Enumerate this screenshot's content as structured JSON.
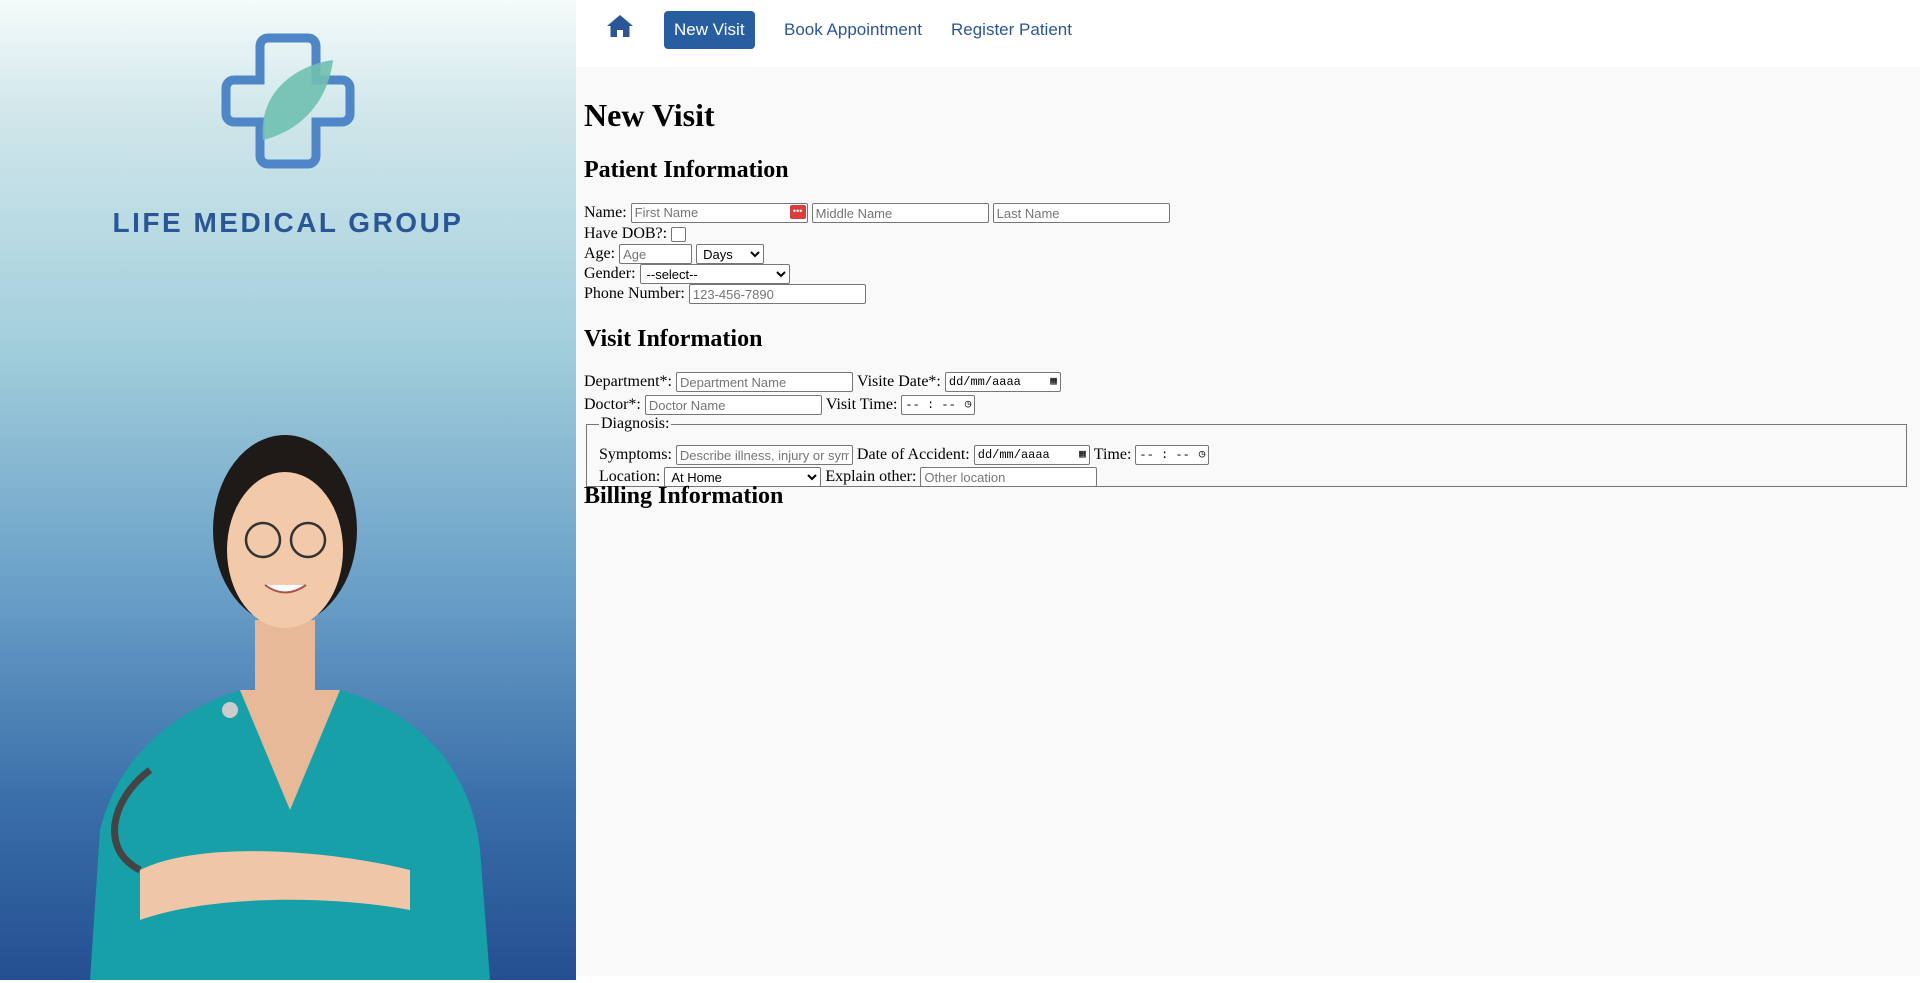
{
  "brand": {
    "name": "LIFE MEDICAL GROUP"
  },
  "nav": {
    "home_icon": "home-icon",
    "items": [
      {
        "label": "New Visit",
        "active": true
      },
      {
        "label": "Book Appointment",
        "active": false
      },
      {
        "label": "Register Patient",
        "active": false
      }
    ]
  },
  "page": {
    "title": "New Visit"
  },
  "patient": {
    "heading": "Patient Information",
    "name_label": "Name:",
    "first_placeholder": "First Name",
    "middle_placeholder": "Middle Name",
    "last_placeholder": "Last Name",
    "dob_label": "Have DOB?:",
    "age_label": "Age:",
    "age_placeholder": "Age",
    "age_unit": "Days",
    "gender_label": "Gender:",
    "gender_value": "--select--",
    "phone_label": "Phone Number:",
    "phone_placeholder": "123-456-7890"
  },
  "visit": {
    "heading": "Visit Information",
    "department_label": "Department*:",
    "department_placeholder": "Department Name",
    "visit_date_label": "Visite Date*:",
    "date_placeholder": "dd/mm/aaaa",
    "doctor_label": "Doctor*:",
    "doctor_placeholder": "Doctor Name",
    "visit_time_label": "Visit Time:",
    "time_placeholder": "-- : --",
    "diagnosis": {
      "legend": "Diagnosis:",
      "symptoms_label": "Symptoms:",
      "symptoms_placeholder": "Describe illness, injury or symptoms",
      "accident_date_label": "Date of Accident:",
      "time_label": "Time:",
      "location_label": "Location:",
      "location_value": "At Home",
      "explain_label": "Explain other:",
      "explain_placeholder": "Other location"
    }
  },
  "billing": {
    "heading": "Billing Information"
  },
  "colors": {
    "accent": "#275ea0",
    "brand": "#2a5696"
  }
}
